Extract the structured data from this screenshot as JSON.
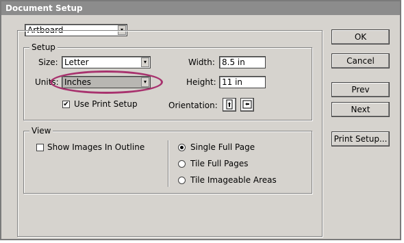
{
  "window": {
    "title": "Document Setup"
  },
  "top_select": {
    "value": "Artboard"
  },
  "setup": {
    "legend": "Setup",
    "size_label": "Size:",
    "size_value": "Letter",
    "units_label": "Units:",
    "units_value": "Inches",
    "use_print_setup_label": "Use Print Setup",
    "use_print_setup_checked": true,
    "width_label": "Width:",
    "width_value": "8.5 in",
    "height_label": "Height:",
    "height_value": "11 in",
    "orientation_label": "Orientation:",
    "orientation_icons": [
      "portrait-icon",
      "landscape-icon"
    ]
  },
  "view": {
    "legend": "View",
    "show_images_label": "Show Images In Outline",
    "show_images_checked": false,
    "radios": [
      {
        "label": "Single Full Page",
        "selected": true
      },
      {
        "label": "Tile Full Pages",
        "selected": false
      },
      {
        "label": "Tile Imageable Areas",
        "selected": false
      }
    ]
  },
  "buttons": {
    "ok": "OK",
    "cancel": "Cancel",
    "prev": "Prev",
    "next": "Next",
    "print_setup": "Print Setup..."
  },
  "colors": {
    "dialog_bg": "#d6d3ce",
    "titlebar_bg": "#8c8c8c",
    "highlight_ellipse": "#a8326e"
  }
}
